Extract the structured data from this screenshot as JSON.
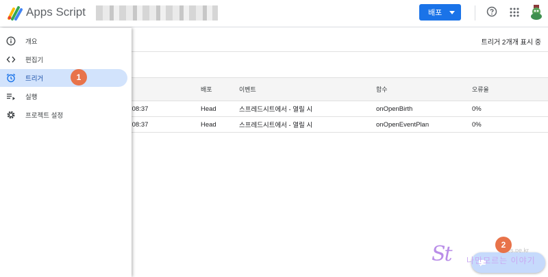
{
  "header": {
    "app_title": "Apps Script",
    "deploy_label": "배포"
  },
  "sidebar": {
    "items": [
      {
        "label": "개요",
        "icon": "info-icon"
      },
      {
        "label": "편집기",
        "icon": "code-icon"
      },
      {
        "label": "트리거",
        "icon": "alarm-clock-icon",
        "active": true
      },
      {
        "label": "실행",
        "icon": "executions-icon"
      },
      {
        "label": "프로젝트 설정",
        "icon": "gear-icon"
      }
    ]
  },
  "main": {
    "trigger_count": "트리거 2개개 표시 중",
    "table": {
      "columns": [
        "배포",
        "이벤트",
        "함수",
        "오류율"
      ],
      "rows": [
        {
          "time": ":08:37",
          "deploy": "Head",
          "event": "스프레드시트에서 - 열릴 시",
          "function": "onOpenBirth",
          "error_rate": "0%"
        },
        {
          "time": ":08:37",
          "deploy": "Head",
          "event": "스프레드시트에서 - 열릴 시",
          "function": "onOpenEventPlan",
          "error_rate": "0%"
        }
      ]
    }
  },
  "annotations": {
    "badge_1": "1",
    "badge_2": "2"
  },
  "overlay": {
    "watermark_mark": "St",
    "watermark_url": "es.pe.kr",
    "watermark_text": "나만모르는 이야기"
  },
  "colors": {
    "accent": "#1a73e8",
    "active_nav_bg": "#d2e3fc",
    "badge": "#e8734a"
  }
}
